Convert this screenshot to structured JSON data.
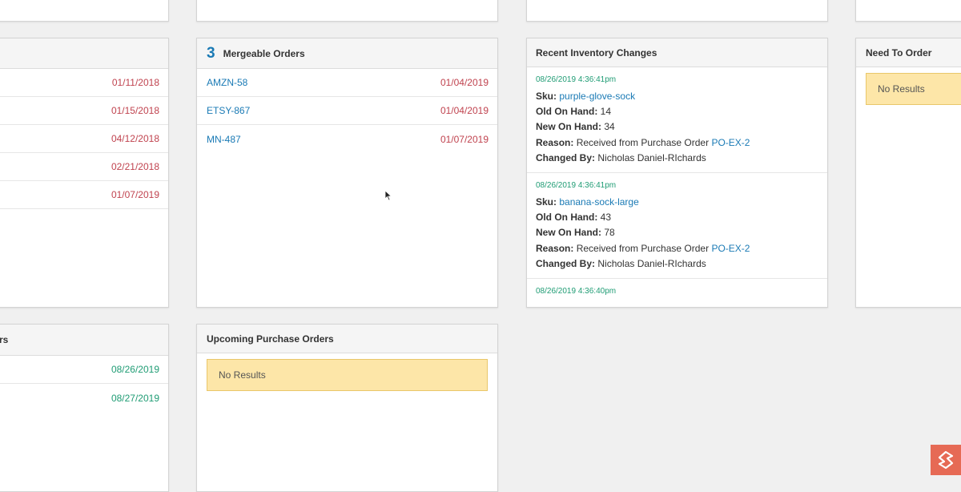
{
  "left_panel_top": {
    "dates": [
      "01/11/2018",
      "01/15/2018",
      "04/12/2018",
      "02/21/2018",
      "01/07/2019"
    ]
  },
  "left_panel_bottom": {
    "title_fragment": "rs",
    "dates": [
      "08/26/2019",
      "08/27/2019"
    ]
  },
  "mergeable_orders": {
    "count": "3",
    "title": "Mergeable Orders",
    "rows": [
      {
        "id": "AMZN-58",
        "date": "01/04/2019"
      },
      {
        "id": "ETSY-867",
        "date": "01/04/2019"
      },
      {
        "id": "MN-487",
        "date": "01/07/2019"
      }
    ]
  },
  "upcoming_purchase_orders": {
    "title": "Upcoming Purchase Orders",
    "empty_text": "No Results"
  },
  "recent_inventory_changes": {
    "title": "Recent Inventory Changes",
    "labels": {
      "sku": "Sku:",
      "old": "Old On Hand:",
      "new": "New On Hand:",
      "reason": "Reason:",
      "changed_by": "Changed By:"
    },
    "entries": [
      {
        "timestamp": "08/26/2019 4:36:41pm",
        "sku": "purple-glove-sock",
        "old_on_hand": "14",
        "new_on_hand": "34",
        "reason_text": "Received from Purchase Order",
        "reason_link": "PO-EX-2",
        "changed_by": "Nicholas Daniel-RIchards"
      },
      {
        "timestamp": "08/26/2019 4:36:41pm",
        "sku": "banana-sock-large",
        "old_on_hand": "43",
        "new_on_hand": "78",
        "reason_text": "Received from Purchase Order",
        "reason_link": "PO-EX-2",
        "changed_by": "Nicholas Daniel-RIchards"
      },
      {
        "timestamp": "08/26/2019 4:36:40pm"
      }
    ]
  },
  "need_to_order": {
    "title": "Need To Order",
    "empty_text": "No Results"
  },
  "colors": {
    "link": "#1a7ab5",
    "date_red": "#c0434f",
    "date_green": "#1f9c74",
    "warning_bg": "#fde6a8",
    "logo": "#e66a55"
  },
  "icons": {
    "logo": "brand-logo-icon",
    "cursor": "mouse-cursor-icon"
  }
}
